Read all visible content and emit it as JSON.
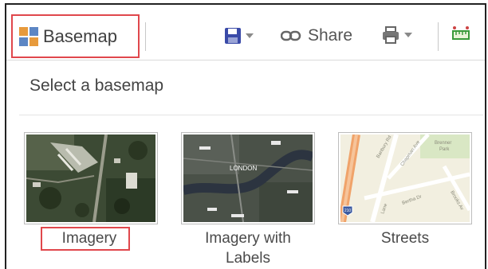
{
  "toolbar": {
    "basemap_label": "Basemap",
    "share_label": "Share",
    "icons": [
      "basemap-grid-icon",
      "save-icon",
      "share-link-icon",
      "print-icon",
      "measure-icon"
    ],
    "colors": {
      "highlight": "#e0474c",
      "save": "#3a4aa8",
      "grid_orange": "#e79a3c",
      "grid_blue": "#5c86c4",
      "measure": "#3a9a3a"
    }
  },
  "panel": {
    "heading": "Select a basemap",
    "basemaps": [
      {
        "label": "Imagery",
        "selected": true
      },
      {
        "label_line1": "Imagery with",
        "label_line2": "Labels"
      },
      {
        "label": "Streets"
      }
    ],
    "map_labels": {
      "london": "LONDON",
      "streets": [
        "Banbury Rd",
        "Chapman Ave",
        "Brenner",
        "Park",
        "Bertha Dr",
        "Brooks Av",
        "Lane"
      ],
      "highway_shield": "210"
    }
  }
}
